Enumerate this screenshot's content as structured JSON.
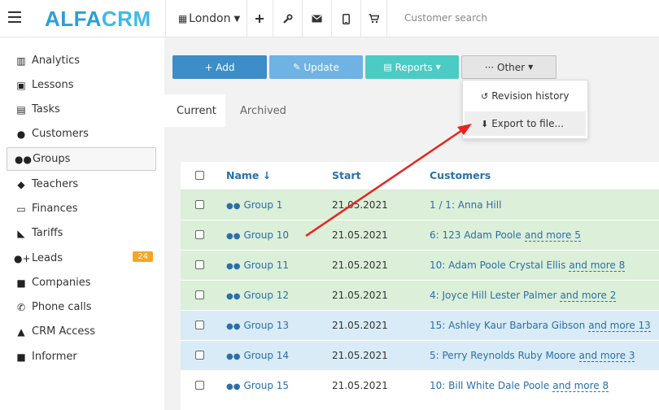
{
  "header": {
    "logo_alfa": "ALFA",
    "logo_crm": "CRM",
    "city": "London",
    "search_placeholder": "Customer search"
  },
  "sidebar": {
    "items": [
      {
        "label": "Analytics",
        "icon": "analytics-icon"
      },
      {
        "label": "Lessons",
        "icon": "calendar-icon"
      },
      {
        "label": "Tasks",
        "icon": "clipboard-icon"
      },
      {
        "label": "Customers",
        "icon": "user-icon"
      },
      {
        "label": "Groups",
        "icon": "group-icon"
      },
      {
        "label": "Teachers",
        "icon": "graduation-cap-icon"
      },
      {
        "label": "Finances",
        "icon": "money-icon"
      },
      {
        "label": "Tariffs",
        "icon": "tag-icon"
      },
      {
        "label": "Leads",
        "icon": "user-plus-icon",
        "badge": "24"
      },
      {
        "label": "Companies",
        "icon": "briefcase-icon"
      },
      {
        "label": "Phone calls",
        "icon": "phone-icon"
      },
      {
        "label": "CRM Access",
        "icon": "lock-icon"
      },
      {
        "label": "Informer",
        "icon": "document-icon"
      }
    ]
  },
  "toolbar": {
    "add": "+ Add",
    "update": "Update",
    "reports": "Reports",
    "other": "··· Other"
  },
  "tabs": {
    "current": "Current",
    "archived": "Archived"
  },
  "dropdown": {
    "revision_history": "Revision history",
    "export": "Export to file..."
  },
  "table": {
    "headers": {
      "name": "Name ↓",
      "start": "Start",
      "customers": "Customers"
    },
    "rows": [
      {
        "name": "Group 1",
        "start": "21.05.2021",
        "customers": "1 / 1:  Anna Hill",
        "more": ""
      },
      {
        "name": "Group 10",
        "start": "21.05.2021",
        "customers": "6:  123  Adam Poole",
        "more": "and more 5"
      },
      {
        "name": "Group 11",
        "start": "21.05.2021",
        "customers": "10:  Adam Poole  Crystal Ellis",
        "more": "and more 8"
      },
      {
        "name": "Group 12",
        "start": "21.05.2021",
        "customers": "4:  Joyce Hill  Lester Palmer",
        "more": "and more 2"
      },
      {
        "name": "Group 13",
        "start": "21.05.2021",
        "customers": "15:  Ashley Kaur  Barbara Gibson",
        "more": "and more 13"
      },
      {
        "name": "Group 14",
        "start": "21.05.2021",
        "customers": "5:  Perry Reynolds  Ruby Moore",
        "more": "and more 3"
      },
      {
        "name": "Group 15",
        "start": "21.05.2021",
        "customers": "10:  Bill White  Dale Poole",
        "more": "and more 8"
      }
    ]
  },
  "colors": {
    "brand": "#2a9fd8",
    "row_green": "#dcefd9",
    "row_blue": "#d9ebf6",
    "badge": "#f5a623",
    "arrow": "#e8231e"
  }
}
